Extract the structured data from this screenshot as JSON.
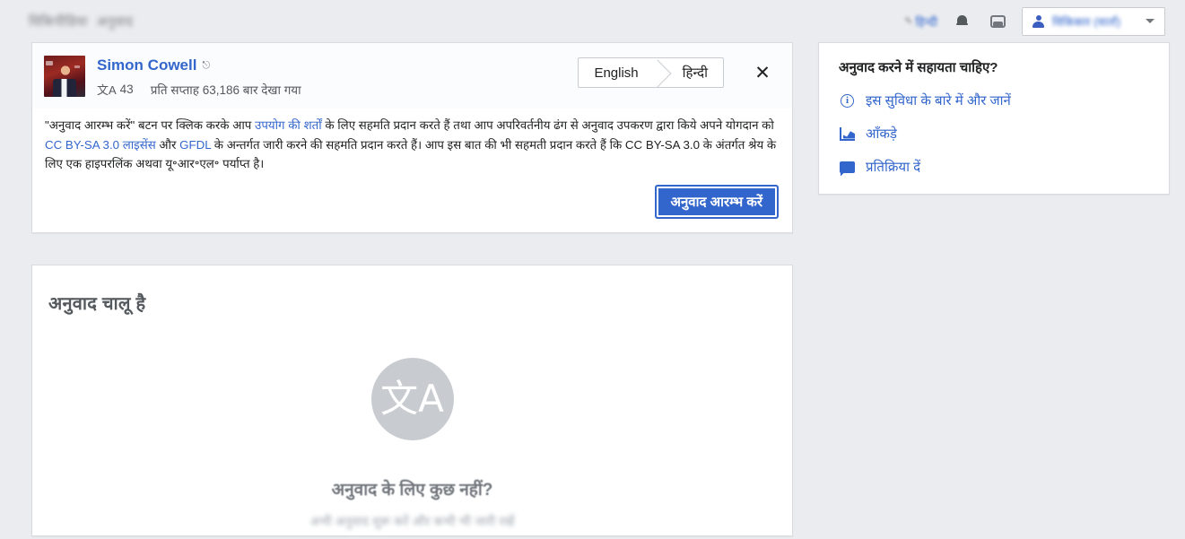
{
  "header": {
    "brand_primary": "विकिपीडिया",
    "brand_secondary": "अनुवाद",
    "lang_chip": "हिन्दी",
    "pen_icon": "pencil-icon",
    "notifications_icon": "bell-icon",
    "messages_icon": "tray-icon",
    "user_name": "विकिकार (वार्ता)",
    "user_icon": "user-icon",
    "caret_icon": "chevron-down-icon"
  },
  "publish_card": {
    "article_title": "Simon Cowell",
    "external_icon": "external-link-icon",
    "translate_glyph": "文A",
    "translation_count": "43",
    "views_text": "प्रति सप्ताह 63,186 बार देखा गया",
    "source_language": "English",
    "target_language": "हिन्दी",
    "close_label": "✕",
    "disclaimer": {
      "part1": "\"अनुवाद आरम्भ करें\" बटन पर क्लिक करके आप ",
      "link1": "उपयोग की शर्तों",
      "part2": " के लिए सहमति प्रदान करते हैं तथा आप अपरिवर्तनीय ढंग से अनुवाद उपकरण द्वारा किये अपने योगदान को ",
      "link2": "CC BY-SA 3.0 लाइसेंस",
      "part3": " और ",
      "link3": "GFDL",
      "part4": " के अन्तर्गत जारी करने की सहमति प्रदान करते हैं। आप इस बात की भी सहमती प्रदान करते हैं कि CC BY-SA 3.0 के अंतर्गत श्रेय के लिए एक हाइपरलिंक अथवा यू॰आर॰एल॰ पर्याप्त है।"
    },
    "publish_button": "अनुवाद आरम्भ करें"
  },
  "translation_list": {
    "title": "अनुवाद चालू है",
    "empty_icon": "translate-icon",
    "empty_glyph": "文A",
    "empty_title": "अनुवाद के लिए कुछ नहीं?",
    "empty_subtitle": "अभी अनुवाद शुरू करें और कभी भी जारी रखें"
  },
  "help_panel": {
    "title": "अनुवाद करने में सहायता चाहिए?",
    "links": [
      {
        "label": "इस सुविधा के बारे में और जानें",
        "icon": "info-icon"
      },
      {
        "label": "आँकड़े",
        "icon": "chart-icon"
      },
      {
        "label": "प्रतिक्रिया दें",
        "icon": "feedback-icon"
      }
    ]
  },
  "colors": {
    "accent": "#3366cc",
    "page_background": "#eaecf0",
    "card_background": "#ffffff",
    "muted_text": "#54595d"
  }
}
